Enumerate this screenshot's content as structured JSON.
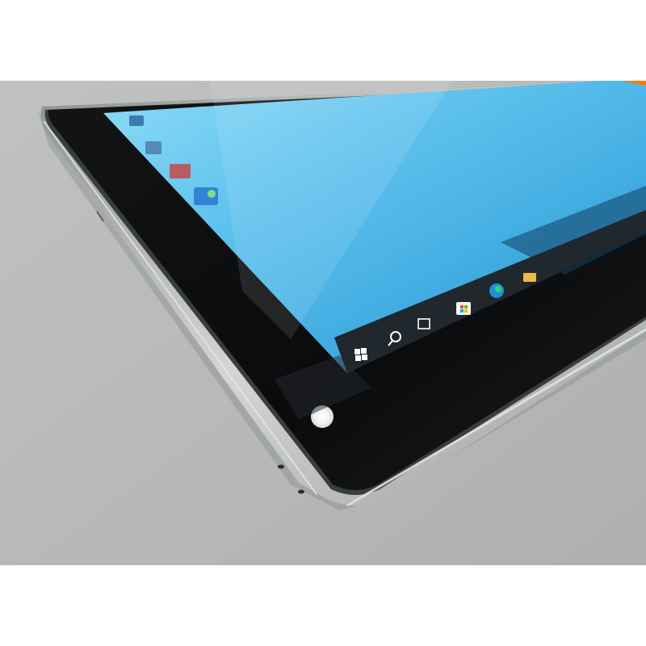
{
  "photo": {
    "subject": "windows-tablet-on-desk",
    "colors": {
      "page_bg": "#ffffff",
      "table": "#b9bbbb",
      "table_dark": "#a8abab",
      "metal_frame": "#c7c9c8",
      "metal_shadow": "#6f7272",
      "bezel": "#0b0c0d",
      "screen_top": "#7fd2f3",
      "screen_mid": "#49b4e6",
      "screen_dark": "#1b6fa6",
      "taskbar": "#20272d",
      "edge_orange": "#ff7a00",
      "reflection": "#2a2d30"
    }
  },
  "desktop": {
    "icons": [
      {
        "name": "this-pc"
      },
      {
        "name": "recycle-bin"
      },
      {
        "name": "photo-file"
      },
      {
        "name": "control-panel"
      }
    ]
  },
  "taskbar": {
    "items": [
      {
        "name": "start-button"
      },
      {
        "name": "search-button"
      },
      {
        "name": "task-view-button"
      },
      {
        "name": "store-app"
      },
      {
        "name": "edge-browser"
      },
      {
        "name": "file-explorer"
      }
    ]
  }
}
